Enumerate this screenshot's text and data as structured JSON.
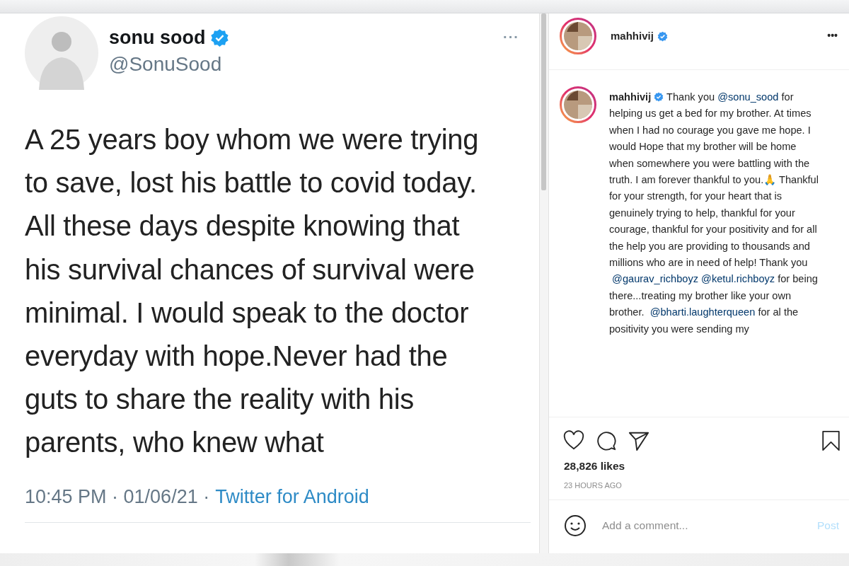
{
  "tweet": {
    "name": "sonu sood",
    "verified": true,
    "handle": "@SonuSood",
    "more": "···",
    "lines": [
      "A 25 years boy whom we were trying",
      "to save,  lost his battle to covid today.",
      "All these days despite knowing that",
      "his survival chances of survival were",
      "minimal. I would  speak to the doctor",
      "everyday with hope.Never had the",
      "guts to share the reality with his",
      "parents, who knew what"
    ],
    "time": "10:45 PM · 01/06/21 ·",
    "source": "Twitter for Android"
  },
  "post": {
    "username": "mahhivij",
    "verified": true,
    "more": "•••",
    "caption": [
      {
        "kind": "author",
        "text": "mahhivij"
      },
      {
        "kind": "text",
        "text": " Thank you "
      },
      {
        "kind": "mention",
        "text": "@sonu_sood"
      },
      {
        "kind": "text",
        "text": " for helping us get a bed for my brother. At times when I had no courage you gave me hope. I would Hope that my brother will be home when somewhere you were battling with the truth. I am forever thankful to you.🙏 Thankful for your strength, for your heart that is genuinely trying to help, thankful for your courage, thankful for your positivity and for all the help you are providing to thousands and millions who are in need of help! Thank you "
      },
      {
        "kind": "mention",
        "text": "@gaurav_richboyz"
      },
      {
        "kind": "mention",
        "text": "@ketul.richboyz"
      },
      {
        "kind": "text",
        "text": " for being there...treating my brother like your own brother. "
      },
      {
        "kind": "mention",
        "text": "@bharti.laughterqueen"
      },
      {
        "kind": "text",
        "text": " for al the positivity you were sending my"
      }
    ],
    "liked": false,
    "saved": false,
    "likes": "28,826 likes",
    "ago": "23 HOURS AGO",
    "comment": {
      "placeholder": "Add a comment..."
    },
    "post_button": "Post",
    "post_enabled": false
  }
}
